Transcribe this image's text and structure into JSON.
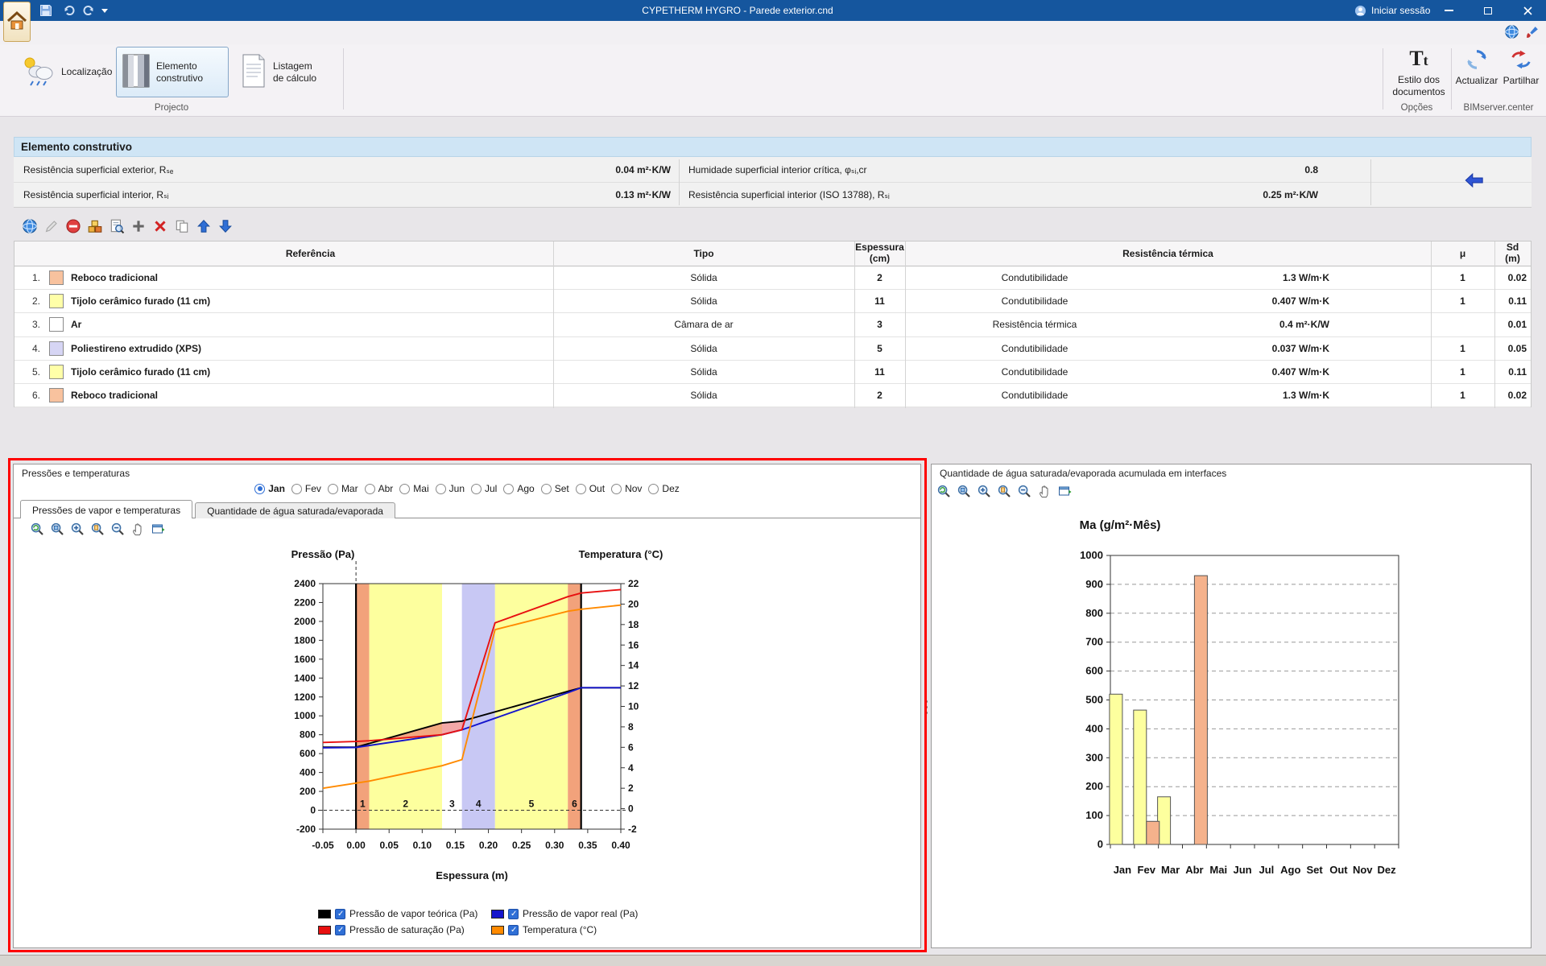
{
  "colors": {
    "titlebar": "#15569e",
    "accent_blue": "#2f6fd6",
    "annotation": "#fe0000"
  },
  "titlebar": {
    "title": "CYPETHERM HYGRO - Parede exterior.cnd",
    "sign_in": "Iniciar sessão"
  },
  "ribbon": {
    "localizacao": "Localização",
    "elemento_construtivo": "Elemento construtivo",
    "listagem_calculo": "Listagem de cálculo",
    "group_projecto": "Projecto",
    "estilo_documentos": "Estilo dos documentos",
    "group_opcoes": "Opções",
    "actualizar": "Actualizar",
    "partilhar": "Partilhar",
    "group_bimserver": "BIMserver.center"
  },
  "section": {
    "header": "Elemento construtivo",
    "properties": [
      {
        "label": "Resistência superficial exterior, Rₛₑ",
        "value": "0.04 m²·K/W"
      },
      {
        "label": "Humidade superficial interior crítica, φₛᵢ,cr",
        "value": "0.8"
      },
      {
        "label": "Resistência superficial interior, Rₛᵢ",
        "value": "0.13 m²·K/W"
      },
      {
        "label": "Resistência superficial interior (ISO 13788), Rₛᵢ",
        "value": "0.25 m²·K/W"
      }
    ]
  },
  "table_toolbar_icons": [
    "globe",
    "pencil",
    "no-entry",
    "blocks",
    "sheet-magnifier",
    "plus",
    "delete-x",
    "copy",
    "arrow-up",
    "arrow-down"
  ],
  "layers_table": {
    "headers": {
      "referencia": "Referência",
      "tipo": "Tipo",
      "espessura_l1": "Espessura",
      "espessura_l2": "(cm)",
      "resistencia": "Resistência térmica",
      "mu": "μ",
      "sd_l1": "Sd",
      "sd_l2": "(m)"
    },
    "rows": [
      {
        "num": "1.",
        "color": "#f8c29e",
        "referencia": "Reboco tradicional",
        "tipo": "Sólida",
        "espessura": "2",
        "res_label": "Condutibilidade",
        "res_value": "1.3 W/m·K",
        "mu": "1",
        "sd": "0.02"
      },
      {
        "num": "2.",
        "color": "#ffffa8",
        "referencia": "Tijolo cerâmico furado (11 cm)",
        "tipo": "Sólida",
        "espessura": "11",
        "res_label": "Condutibilidade",
        "res_value": "0.407 W/m·K",
        "mu": "1",
        "sd": "0.11"
      },
      {
        "num": "3.",
        "color": "#ffffff",
        "referencia": "Ar",
        "tipo": "Câmara de ar",
        "espessura": "3",
        "res_label": "Resistência térmica",
        "res_value": "0.4 m²·K/W",
        "mu": "",
        "sd": "0.01"
      },
      {
        "num": "4.",
        "color": "#d6d5f4",
        "referencia": "Poliestireno extrudido (XPS)",
        "tipo": "Sólida",
        "espessura": "5",
        "res_label": "Condutibilidade",
        "res_value": "0.037 W/m·K",
        "mu": "1",
        "sd": "0.05"
      },
      {
        "num": "5.",
        "color": "#ffffa8",
        "referencia": "Tijolo cerâmico furado (11 cm)",
        "tipo": "Sólida",
        "espessura": "11",
        "res_label": "Condutibilidade",
        "res_value": "0.407 W/m·K",
        "mu": "1",
        "sd": "0.11"
      },
      {
        "num": "6.",
        "color": "#f8c29e",
        "referencia": "Reboco tradicional",
        "tipo": "Sólida",
        "espessura": "2",
        "res_label": "Condutibilidade",
        "res_value": "1.3 W/m·K",
        "mu": "1",
        "sd": "0.02"
      }
    ]
  },
  "left_panel": {
    "title": "Pressões e temperaturas",
    "months": [
      "Jan",
      "Fev",
      "Mar",
      "Abr",
      "Mai",
      "Jun",
      "Jul",
      "Ago",
      "Set",
      "Out",
      "Nov",
      "Dez"
    ],
    "selected_month_index": 0,
    "tabs": [
      "Pressões de vapor e temperaturas",
      "Quantidade de água saturada/evaporada"
    ],
    "active_tab_index": 0,
    "toolbar_icons": [
      "zoom-reset",
      "zoom-window",
      "zoom-in",
      "zoom-page",
      "zoom-out",
      "pan",
      "export"
    ]
  },
  "right_panel": {
    "title": "Quantidade de água saturada/evaporada acumulada em interfaces",
    "toolbar_icons": [
      "zoom-reset",
      "zoom-window",
      "zoom-in",
      "zoom-page",
      "zoom-out",
      "pan",
      "export"
    ]
  },
  "chart_data": [
    {
      "type": "line",
      "xlabel": "Espessura (m)",
      "ylabel_left": "Pressão (Pa)",
      "ylabel_right": "Temperatura (°C)",
      "xlim": [
        -0.05,
        0.4
      ],
      "x_tick_step": 0.05,
      "ylim_left": [
        -200,
        2400
      ],
      "ytick_step_left": 200,
      "ylim_right": [
        -2,
        22
      ],
      "ytick_step_right": 2,
      "wall_boundaries": [
        0,
        0.34
      ],
      "layer_bands": [
        {
          "label": "1",
          "from": 0.0,
          "to": 0.02,
          "color": "#f2a27b"
        },
        {
          "label": "2",
          "from": 0.02,
          "to": 0.13,
          "color": "#fdff9e"
        },
        {
          "label": "3",
          "from": 0.13,
          "to": 0.16,
          "color": "#ffffff"
        },
        {
          "label": "4",
          "from": 0.16,
          "to": 0.21,
          "color": "#c8c8f4"
        },
        {
          "label": "5",
          "from": 0.21,
          "to": 0.32,
          "color": "#fdff9e"
        },
        {
          "label": "6",
          "from": 0.32,
          "to": 0.34,
          "color": "#f2a27b"
        }
      ],
      "condensation_fill": "rgba(236,110,110,0.6)",
      "series": [
        {
          "name": "Pressão de vapor teórica (Pa)",
          "color": "#000000",
          "axis": "left",
          "checked": true,
          "points": [
            [
              -0.05,
              668
            ],
            [
              0,
              668
            ],
            [
              0.02,
              707
            ],
            [
              0.13,
              924
            ],
            [
              0.16,
              944
            ],
            [
              0.21,
              1042
            ],
            [
              0.32,
              1259
            ],
            [
              0.34,
              1298
            ],
            [
              0.4,
              1298
            ]
          ]
        },
        {
          "name": "Pressão de vapor real (Pa)",
          "color": "#1515cc",
          "axis": "left",
          "checked": true,
          "points": [
            [
              -0.05,
              662
            ],
            [
              0,
              665
            ],
            [
              0.13,
              800
            ],
            [
              0.16,
              852
            ],
            [
              0.21,
              975
            ],
            [
              0.32,
              1245
            ],
            [
              0.34,
              1298
            ],
            [
              0.4,
              1298
            ]
          ]
        },
        {
          "name": "Pressão de saturação (Pa)",
          "color": "#e81010",
          "axis": "left",
          "checked": true,
          "points": [
            [
              -0.05,
              718
            ],
            [
              0,
              728
            ],
            [
              0.02,
              736
            ],
            [
              0.13,
              800
            ],
            [
              0.16,
              852
            ],
            [
              0.21,
              1985
            ],
            [
              0.32,
              2262
            ],
            [
              0.34,
              2300
            ],
            [
              0.4,
              2337
            ]
          ]
        },
        {
          "name": "Temperatura (°C)",
          "color": "#ff8a00",
          "axis": "right",
          "checked": true,
          "points": [
            [
              -0.05,
              2.0
            ],
            [
              0,
              2.5
            ],
            [
              0.02,
              2.7
            ],
            [
              0.13,
              4.2
            ],
            [
              0.16,
              4.8
            ],
            [
              0.21,
              17.5
            ],
            [
              0.32,
              19.3
            ],
            [
              0.34,
              19.5
            ],
            [
              0.4,
              19.9
            ]
          ]
        }
      ]
    },
    {
      "type": "bar",
      "title": "Ma (g/m²·Mês)",
      "categories": [
        "Jan",
        "Fev",
        "Mar",
        "Abr",
        "Mai",
        "Jun",
        "Jul",
        "Ago",
        "Set",
        "Out",
        "Nov",
        "Dez"
      ],
      "ylim": [
        0,
        1000
      ],
      "ytick_step": 100,
      "grid": "dashed",
      "series": [
        {
          "color": "#fdff9e",
          "values": [
            520,
            465,
            165,
            0,
            0,
            0,
            0,
            0,
            0,
            0,
            0,
            0
          ]
        },
        {
          "color": "#f5b28c",
          "values": [
            0,
            80,
            0,
            930,
            0,
            0,
            0,
            0,
            0,
            0,
            0,
            0
          ]
        }
      ]
    }
  ]
}
